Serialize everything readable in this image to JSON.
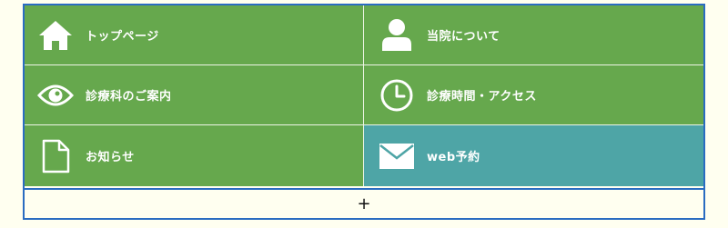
{
  "menu": {
    "items": [
      {
        "label": "トップページ",
        "icon": "home-icon"
      },
      {
        "label": "当院について",
        "icon": "person-icon"
      },
      {
        "label": "診療科のご案内",
        "icon": "eye-icon"
      },
      {
        "label": "診療時間・アクセス",
        "icon": "clock-icon"
      },
      {
        "label": "お知らせ",
        "icon": "document-icon"
      },
      {
        "label": "web予約",
        "icon": "mail-icon"
      }
    ],
    "expand_label": "+"
  },
  "colors": {
    "green": "#66a84d",
    "teal": "#4ea5a6",
    "border": "#2a6cc1",
    "background": "#fffff0"
  }
}
